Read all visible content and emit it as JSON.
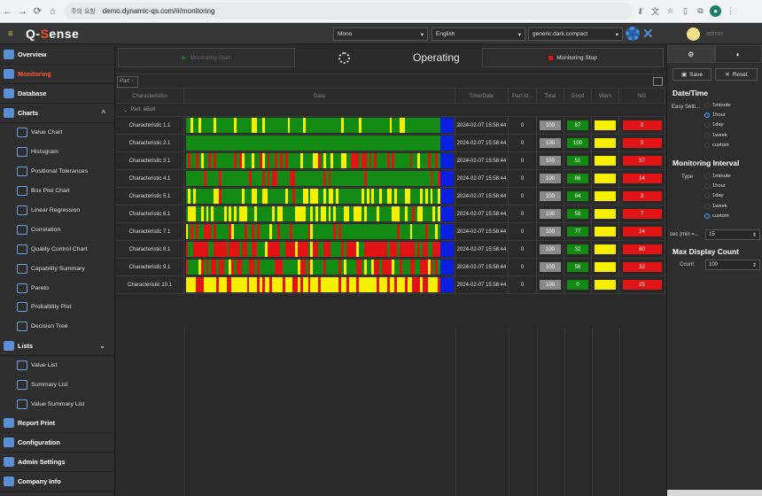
{
  "browser": {
    "security_label": "주의 요함",
    "url": "demo.dynamic-qs.com/#/monitoring"
  },
  "header": {
    "logo_prefix": "Q-",
    "logo_accent": "S",
    "logo_suffix": "ense",
    "select_mode": "Mono",
    "select_language": "English",
    "select_theme": "generic.dark.compact",
    "user": "admin"
  },
  "sidebar": {
    "items": [
      {
        "label": "Overview"
      },
      {
        "label": "Monitoring"
      },
      {
        "label": "Database"
      },
      {
        "label": "Charts"
      }
    ],
    "charts": [
      "Value Chart",
      "Histogram",
      "Positional Tolerances",
      "Box Plot Chart",
      "Linear Regression",
      "Correlation",
      "Quality Control Chart",
      "Capability Summary",
      "Pareto",
      "Probability Plot",
      "Decision Tree"
    ],
    "lists_label": "Lists",
    "lists": [
      "Value List",
      "Summary List",
      "Value Summary List"
    ],
    "bottom": [
      "Report Print",
      "Configuration",
      "Admin Settings",
      "Company Info"
    ]
  },
  "main": {
    "start_label": "Monitoring Start",
    "status_text": "Operating",
    "stop_label": "Monitoring Stop",
    "part_filter": "Part",
    "columns": [
      "Characteristics",
      "Data",
      "Time/Date",
      "Part Id...",
      "Total",
      "Good",
      "Warn",
      "NG"
    ],
    "group_label": "Part: eBolt",
    "rows": [
      {
        "name": "Characteristic 1.1",
        "time": "2024-02-07 15:58:44",
        "part": "0",
        "total": "100",
        "good": "87",
        "warn": "",
        "ng": "0"
      },
      {
        "name": "Characteristic 2.1",
        "time": "2024-02-07 15:58:44",
        "part": "0",
        "total": "100",
        "good": "100",
        "warn": "",
        "ng": "0"
      },
      {
        "name": "Characteristic 3.1",
        "time": "2024-02-07 15:58:44",
        "part": "0",
        "total": "100",
        "good": "51",
        "warn": "",
        "ng": "37"
      },
      {
        "name": "Characteristic 4.1",
        "time": "2024-02-07 15:58:44",
        "part": "0",
        "total": "100",
        "good": "86",
        "warn": "",
        "ng": "14"
      },
      {
        "name": "Characteristic 5.1",
        "time": "2024-02-07 15:58:44",
        "part": "0",
        "total": "100",
        "good": "64",
        "warn": "",
        "ng": "3"
      },
      {
        "name": "Characteristic 6.1",
        "time": "2024-02-07 15:58:44",
        "part": "0",
        "total": "100",
        "good": "58",
        "warn": "",
        "ng": "7"
      },
      {
        "name": "Characteristic 7.1",
        "time": "2024-02-07 15:58:44",
        "part": "0",
        "total": "100",
        "good": "77",
        "warn": "",
        "ng": "14"
      },
      {
        "name": "Characteristic 8.1",
        "time": "2024-02-07 15:58:44",
        "part": "0",
        "total": "100",
        "good": "32",
        "warn": "",
        "ng": "60"
      },
      {
        "name": "Characteristic 9.1",
        "time": "2024-02-07 15:58:44",
        "part": "0",
        "total": "100",
        "good": "56",
        "warn": "",
        "ng": "32"
      },
      {
        "name": "Characteristic 10.1",
        "time": "2024-02-07 15:58:44",
        "part": "0",
        "total": "100",
        "good": "0",
        "warn": "",
        "ng": "25"
      }
    ],
    "status_colors": {
      "good": "#138a13",
      "warn": "#f6f000",
      "ng": "#e01414",
      "latest": "#0a1fe0"
    }
  },
  "right": {
    "save_label": "Save",
    "reset_label": "Reset",
    "datetime_title": "Date/Time",
    "easy_setting_label": "Easy Setti...",
    "range_options": [
      "1minute",
      "1hour",
      "1day",
      "1week",
      "custom"
    ],
    "range_selected": "1hour",
    "interval_title": "Monitoring Interval",
    "type_label": "Type",
    "interval_options": [
      "1minute",
      "1hour",
      "1day",
      "1week",
      "custom"
    ],
    "interval_selected": "custom",
    "sec_label": "sec (min =...",
    "sec_value": "15",
    "max_title": "Max Display Count",
    "count_label": "Count",
    "count_value": "100"
  }
}
